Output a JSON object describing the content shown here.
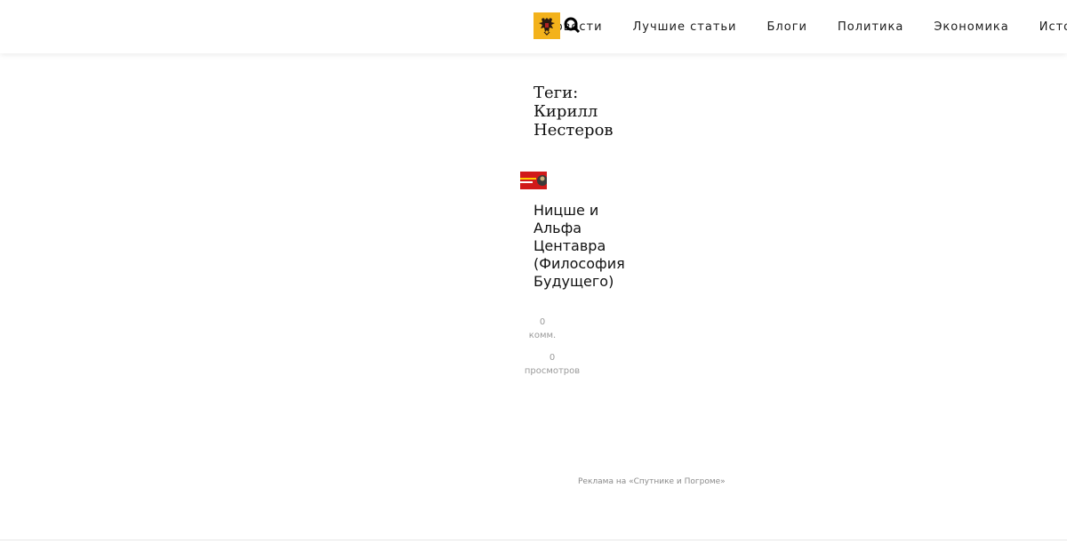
{
  "header": {
    "logo_icon": "double-headed-eagle-icon",
    "search_icon": "search-icon",
    "nav": [
      "Новости",
      "Лучшие статьи",
      "Блоги",
      "Политика",
      "Экономика",
      "История"
    ]
  },
  "tags": {
    "title": "Теги: Кирилл Нестеров"
  },
  "post": {
    "title": "Ницше и Альфа Центавра (Философия Будущего)",
    "comments_count": "0",
    "comments_label": "комм.",
    "views_count": "0",
    "views_label": "просмотров"
  },
  "ad": {
    "label": "Реклама на «Спутнике и Погроме»"
  },
  "colors": {
    "logo_bg": "#f3b21b",
    "thumb_bg": "#d11a1a",
    "meta_text": "#9a9a9a"
  }
}
